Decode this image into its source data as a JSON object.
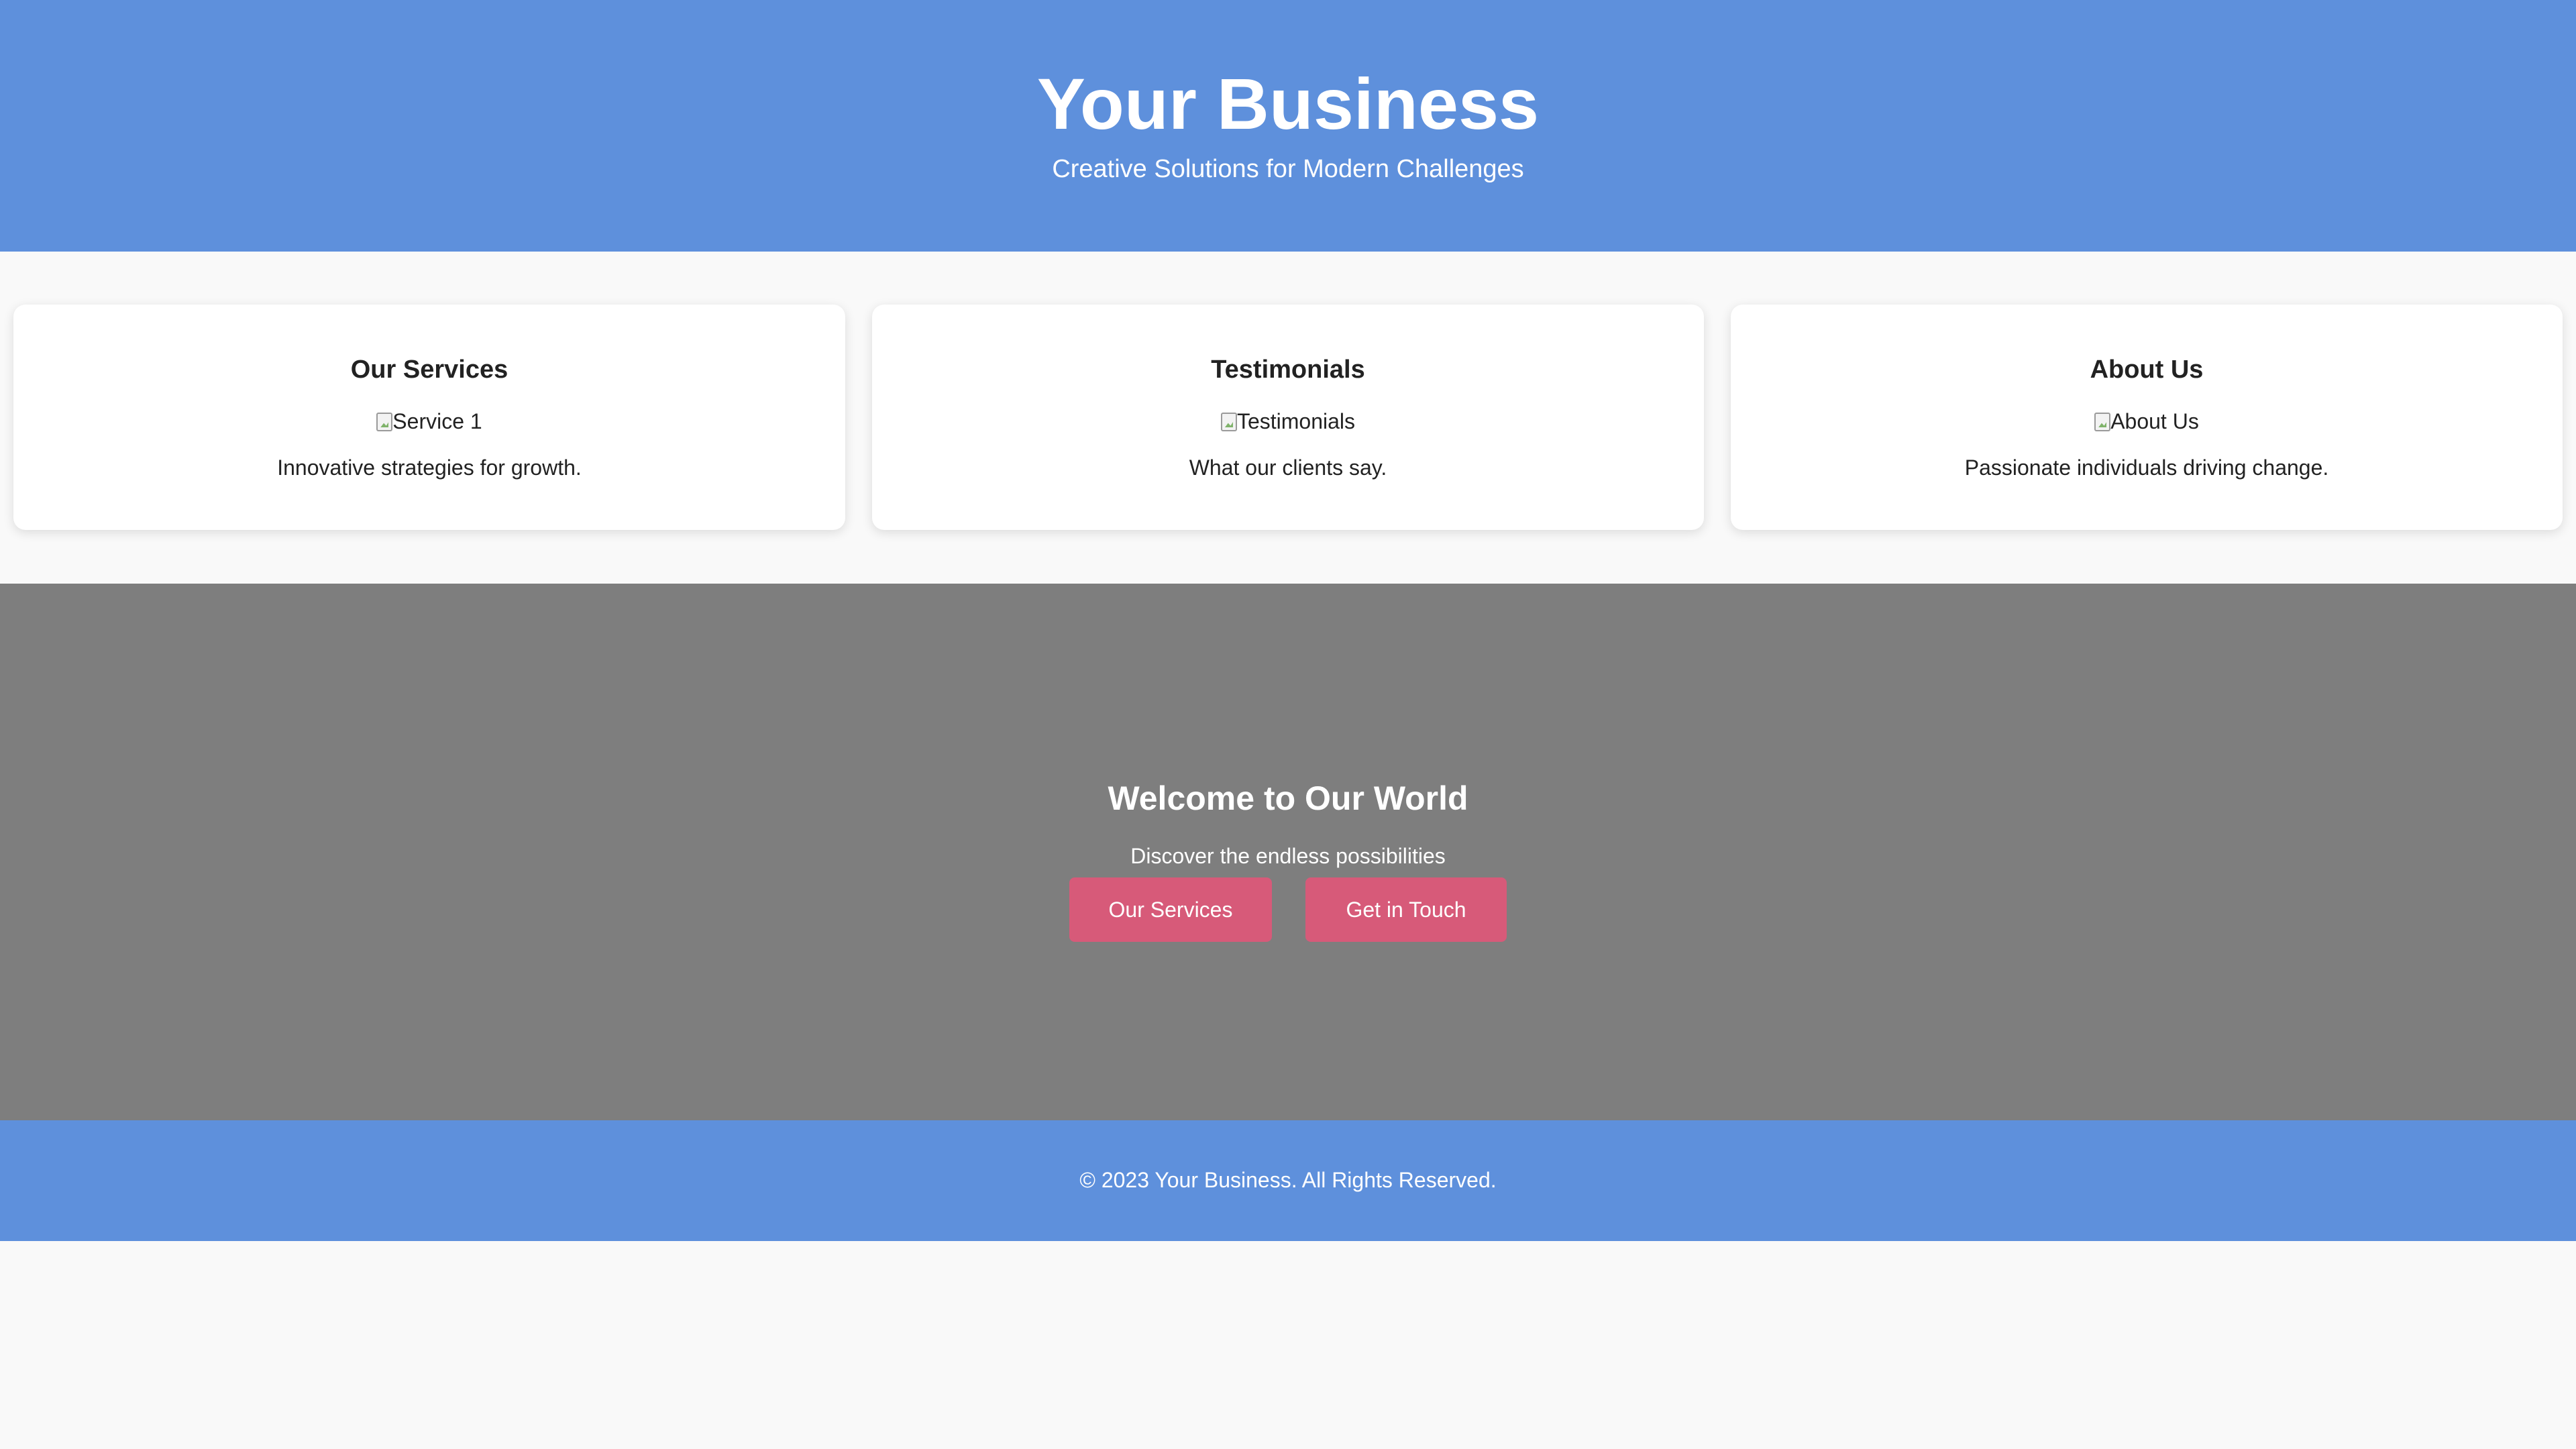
{
  "header": {
    "title": "Your Business",
    "subtitle": "Creative Solutions for Modern Challenges"
  },
  "cards": [
    {
      "title": "Our Services",
      "image_alt": "Service 1",
      "text": "Innovative strategies for growth."
    },
    {
      "title": "Testimonials",
      "image_alt": "Testimonials",
      "text": "What our clients say."
    },
    {
      "title": "About Us",
      "image_alt": "About Us",
      "text": "Passionate individuals driving change."
    }
  ],
  "hero": {
    "title": "Welcome to Our World",
    "subtitle": "Discover the endless possibilities",
    "buttons": [
      {
        "label": "Our Services"
      },
      {
        "label": "Get in Touch"
      }
    ]
  },
  "footer": {
    "text": "© 2023 Your Business. All Rights Reserved."
  },
  "colors": {
    "brand_blue": "#5e90dc",
    "hero_gray": "#7e7e7e",
    "button_pink": "#d75a79",
    "page_background": "#f9f9f9"
  },
  "icons": {
    "broken_image": "broken-image-icon"
  }
}
